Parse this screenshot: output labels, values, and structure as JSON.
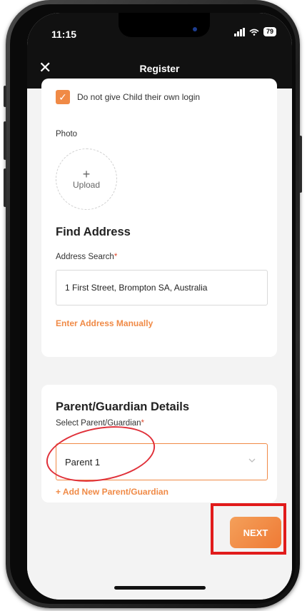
{
  "status": {
    "time": "11:15",
    "battery": "79"
  },
  "nav": {
    "title": "Register"
  },
  "form": {
    "checkbox_label": "Do not give Child their own login",
    "photo_label": "Photo",
    "upload_label": "Upload",
    "find_address_title": "Find Address",
    "address_search_label": "Address Search",
    "address_value": "1 First Street, Brompton SA, Australia",
    "enter_manually_link": "Enter Address Manually",
    "parent_title": "Parent/Guardian Details",
    "select_parent_label": "Select Parent/Guardian",
    "select_parent_value": "Parent 1",
    "add_parent_link": "+ Add New Parent/Guardian",
    "required_mark": "*"
  },
  "actions": {
    "next_label": "NEXT"
  },
  "colors": {
    "accent": "#f08a46",
    "annotation": "#e11b1b"
  }
}
